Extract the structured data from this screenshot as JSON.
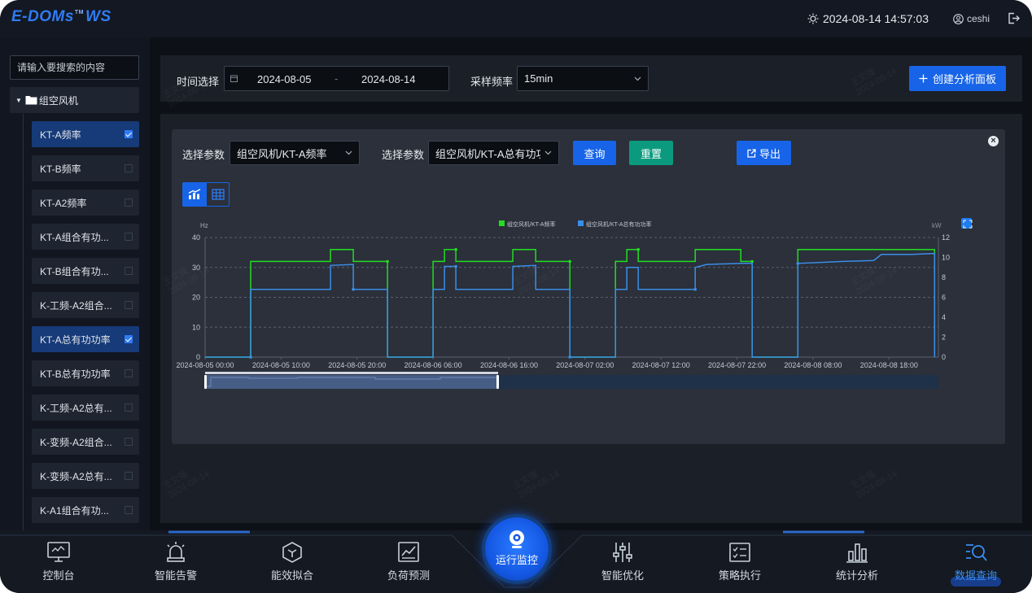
{
  "header": {
    "logo_main": "E-DOMs",
    "logo_tm": "TM",
    "logo_suffix": "WS",
    "datetime": "2024-08-14 14:57:03",
    "user": "ceshi"
  },
  "sidebar": {
    "search_placeholder": "请输入要搜索的内容",
    "root_label": "组空风机",
    "items": [
      {
        "label": "KT-A频率",
        "checked": true
      },
      {
        "label": "KT-B频率",
        "checked": false
      },
      {
        "label": "KT-A2频率",
        "checked": false
      },
      {
        "label": "KT-A组合有功...",
        "checked": false
      },
      {
        "label": "KT-B组合有功...",
        "checked": false
      },
      {
        "label": "K-工频-A2组合...",
        "checked": false
      },
      {
        "label": "KT-A总有功功率",
        "checked": true
      },
      {
        "label": "KT-B总有功功率",
        "checked": false
      },
      {
        "label": "K-工频-A2总有...",
        "checked": false
      },
      {
        "label": "K-变频-A2组合...",
        "checked": false
      },
      {
        "label": "K-变频-A2总有...",
        "checked": false
      },
      {
        "label": "K-A1组合有功...",
        "checked": false
      }
    ]
  },
  "filter": {
    "time_label": "时间选择",
    "start_date": "2024-08-05",
    "date_sep": "-",
    "end_date": "2024-08-14",
    "freq_label": "采样频率",
    "freq_value": "15min",
    "create_button": "创建分析面板"
  },
  "panel": {
    "param_label_1": "选择参数",
    "param_value_1": "组空风机/KT-A频率",
    "param_label_2": "选择参数",
    "param_value_2": "组空风机/KT-A总有功功率",
    "query_button": "查询",
    "reset_button": "重置",
    "export_button": "导出",
    "colors": {
      "query": "#1764e8",
      "reset": "#0b9a7e",
      "export": "#1764e8",
      "series1": "#22dd22",
      "series2": "#3a8ee8"
    }
  },
  "chart_data": {
    "type": "line",
    "y_left": {
      "label": "Hz",
      "ticks": [
        0,
        10,
        20,
        30,
        40
      ],
      "lim": [
        0,
        40
      ]
    },
    "y_right": {
      "label": "kW",
      "ticks": [
        0,
        2,
        4,
        6,
        8,
        10,
        12
      ],
      "lim": [
        0,
        12
      ]
    },
    "x_ticks": [
      "2024-08-05 00:00",
      "2024-08-05 10:00",
      "2024-08-05 20:00",
      "2024-08-06 06:00",
      "2024-08-06 16:00",
      "2024-08-07 02:00",
      "2024-08-07 12:00",
      "2024-08-07 22:00",
      "2024-08-08 08:00",
      "2024-08-08 18:00"
    ],
    "x_range_hours": [
      0,
      96.5
    ],
    "grid": true,
    "legend_position": "top-center",
    "series": [
      {
        "name": "组空风机/KT-A频率",
        "axis": "left",
        "points": [
          [
            0,
            0
          ],
          [
            6,
            0
          ],
          [
            6,
            32
          ],
          [
            16.5,
            32
          ],
          [
            16.5,
            36
          ],
          [
            19.5,
            36
          ],
          [
            19.5,
            32
          ],
          [
            24,
            32
          ],
          [
            24,
            0
          ],
          [
            30,
            0
          ],
          [
            30,
            32
          ],
          [
            31.5,
            32
          ],
          [
            31.5,
            36
          ],
          [
            33,
            36
          ],
          [
            33,
            32
          ],
          [
            40.5,
            32
          ],
          [
            40.5,
            36
          ],
          [
            43.5,
            36
          ],
          [
            43.5,
            32
          ],
          [
            48,
            32
          ],
          [
            48,
            0
          ],
          [
            54,
            0
          ],
          [
            54,
            32
          ],
          [
            55.5,
            32
          ],
          [
            55.5,
            36
          ],
          [
            57,
            36
          ],
          [
            57,
            32
          ],
          [
            64.5,
            32
          ],
          [
            64.5,
            36
          ],
          [
            70.5,
            36
          ],
          [
            70.5,
            32
          ],
          [
            72,
            32
          ],
          [
            72,
            0
          ],
          [
            78,
            0
          ],
          [
            78,
            36
          ],
          [
            96,
            36
          ],
          [
            96,
            0
          ]
        ]
      },
      {
        "name": "组空风机/KT-A总有功功率",
        "axis": "right",
        "points": [
          [
            0,
            0
          ],
          [
            6,
            0
          ],
          [
            6,
            6.8
          ],
          [
            10,
            6.8
          ],
          [
            16,
            6.8
          ],
          [
            16.5,
            6.8
          ],
          [
            16.5,
            9.2
          ],
          [
            19.5,
            9.3
          ],
          [
            19.5,
            6.8
          ],
          [
            24,
            6.8
          ],
          [
            24,
            0
          ],
          [
            30,
            0
          ],
          [
            30,
            6.8
          ],
          [
            31.5,
            6.8
          ],
          [
            31.5,
            9.1
          ],
          [
            33,
            9.1
          ],
          [
            33,
            6.8
          ],
          [
            40.5,
            6.8
          ],
          [
            40.5,
            9.1
          ],
          [
            43.5,
            9.2
          ],
          [
            43.5,
            6.8
          ],
          [
            48,
            6.8
          ],
          [
            48,
            0
          ],
          [
            54,
            0
          ],
          [
            54,
            6.8
          ],
          [
            55.5,
            6.8
          ],
          [
            55.5,
            9.0
          ],
          [
            57,
            9.0
          ],
          [
            57,
            6.8
          ],
          [
            64.5,
            6.8
          ],
          [
            64.5,
            9.0
          ],
          [
            66,
            9.3
          ],
          [
            70.5,
            9.4
          ],
          [
            72,
            9.4
          ],
          [
            72,
            0
          ],
          [
            78,
            0
          ],
          [
            78,
            9.4
          ],
          [
            84,
            9.6
          ],
          [
            88,
            9.7
          ],
          [
            89,
            10.3
          ],
          [
            93,
            10.3
          ],
          [
            96,
            10.4
          ],
          [
            96,
            0
          ]
        ]
      }
    ]
  },
  "bottom_nav": [
    {
      "label": "控制台",
      "icon": "monitor-icon"
    },
    {
      "label": "智能告警",
      "icon": "alarm-icon"
    },
    {
      "label": "能效拟合",
      "icon": "cube-icon"
    },
    {
      "label": "负荷预测",
      "icon": "trend-icon"
    },
    {
      "label": "运行监控",
      "icon": "camera-icon"
    },
    {
      "label": "智能优化",
      "icon": "sliders-icon"
    },
    {
      "label": "策略执行",
      "icon": "checklist-icon"
    },
    {
      "label": "统计分析",
      "icon": "bar-chart-icon"
    },
    {
      "label": "数据查询",
      "icon": "data-search-icon"
    }
  ],
  "watermark": {
    "name": "王文强",
    "date": "2024-08-14"
  }
}
